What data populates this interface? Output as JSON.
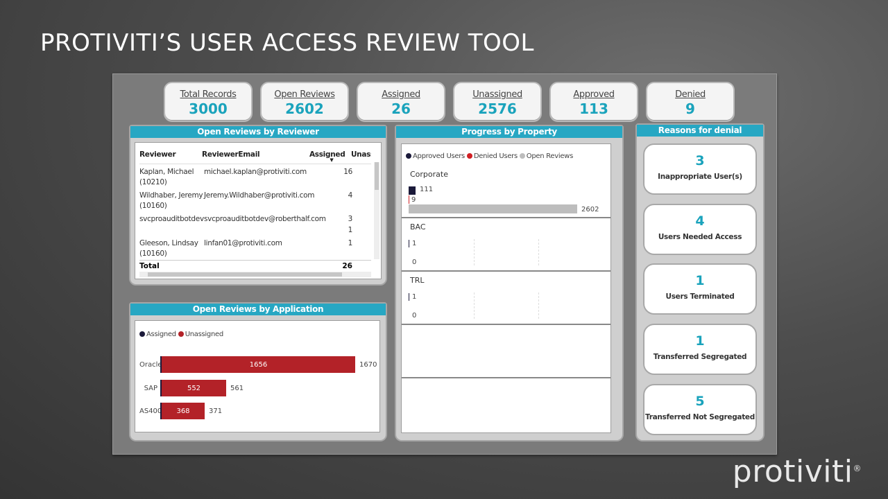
{
  "slide": {
    "title": "PROTIVITI’S USER ACCESS REVIEW TOOL",
    "brand": "protiviti",
    "brand_mark": "®"
  },
  "kpis": [
    {
      "label": "Total Records",
      "value": "3000"
    },
    {
      "label": "Open Reviews",
      "value": "2602"
    },
    {
      "label": "Assigned",
      "value": "26"
    },
    {
      "label": "Unassigned",
      "value": "2576"
    },
    {
      "label": "Approved",
      "value": "113"
    },
    {
      "label": "Denied",
      "value": "9"
    }
  ],
  "reviewer_panel": {
    "title": "Open Reviews by Reviewer",
    "columns": [
      "Reviewer",
      "ReviewerEmail",
      "Assigned",
      "Unass"
    ],
    "rows": [
      {
        "reviewer": "Kaplan, Michael (10210)",
        "email": "michael.kaplan@protiviti.com",
        "assigned": "16"
      },
      {
        "reviewer": "Wildhaber, Jeremy (10160)",
        "email": "Jeremy.Wildhaber@protiviti.com",
        "assigned": "4"
      },
      {
        "reviewer": "svcproauditbotdev",
        "email": "svcproauditbotdev@roberthalf.com",
        "assigned": "3"
      },
      {
        "reviewer": "",
        "email": "",
        "assigned": "1"
      },
      {
        "reviewer": "Gleeson, Lindsay (10160)",
        "email": "linfan01@protiviti.com",
        "assigned": "1"
      }
    ],
    "total_label": "Total",
    "total_value": "26"
  },
  "application_panel": {
    "title": "Open Reviews by Application",
    "legend": [
      {
        "label": "Assigned",
        "color": "#1b1a3a"
      },
      {
        "label": "Unassigned",
        "color": "#b32228"
      }
    ]
  },
  "property_panel": {
    "title": "Progress by Property",
    "legend": [
      {
        "label": "Approved Users",
        "color": "#1b1a3a"
      },
      {
        "label": "Denied Users",
        "color": "#d11f24"
      },
      {
        "label": "Open Reviews",
        "color": "#bdbdbd"
      }
    ],
    "sections": [
      {
        "name": "Corporate",
        "labels": [
          "111",
          "9",
          "2602"
        ]
      },
      {
        "name": "BAC",
        "labels": [
          "1",
          "0"
        ]
      },
      {
        "name": "TRL",
        "labels": [
          "1",
          "0"
        ]
      }
    ]
  },
  "denial_panel": {
    "title": "Reasons for denial",
    "cards": [
      {
        "count": "3",
        "label": "Inappropriate User(s)"
      },
      {
        "count": "4",
        "label": "Users Needed Access"
      },
      {
        "count": "1",
        "label": "Users Terminated"
      },
      {
        "count": "1",
        "label": "Transferred Segregated"
      },
      {
        "count": "5",
        "label": "Transferred Not Segregated"
      }
    ]
  },
  "chart_data": [
    {
      "type": "bar",
      "orientation": "horizontal",
      "title": "Open Reviews by Application",
      "categories": [
        "Oracle",
        "SAP",
        "AS400"
      ],
      "series": [
        {
          "name": "Assigned",
          "values": [
            14,
            9,
            3
          ]
        },
        {
          "name": "Unassigned",
          "values": [
            1656,
            552,
            368
          ]
        }
      ],
      "totals": [
        1670,
        561,
        371
      ],
      "stacked": true
    },
    {
      "type": "bar",
      "orientation": "horizontal",
      "title": "Progress by Property",
      "categories": [
        "Corporate",
        "BAC",
        "TRL"
      ],
      "series": [
        {
          "name": "Approved Users",
          "values": [
            111,
            1,
            1
          ]
        },
        {
          "name": "Denied Users",
          "values": [
            9,
            0,
            0
          ]
        },
        {
          "name": "Open Reviews",
          "values": [
            2602,
            null,
            null
          ]
        }
      ]
    }
  ]
}
